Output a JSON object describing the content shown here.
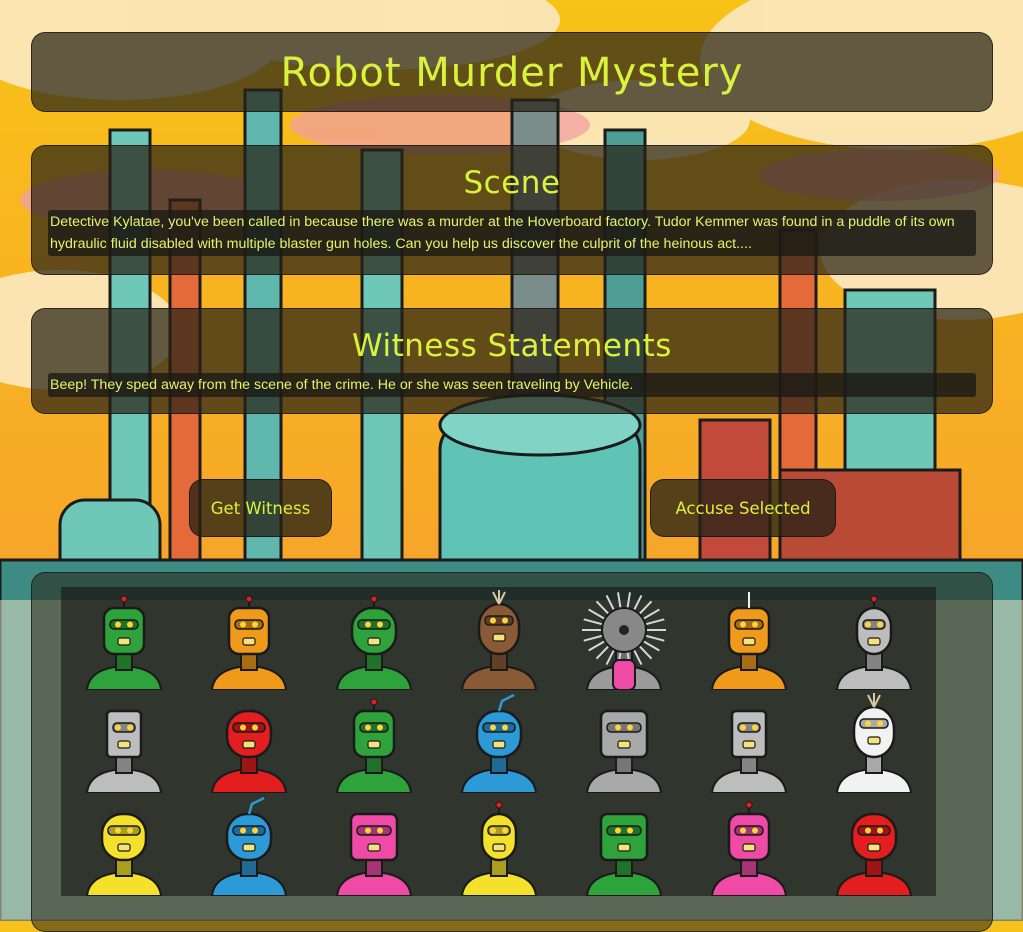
{
  "game": {
    "title": "Robot Murder Mystery"
  },
  "scene": {
    "heading": "Scene",
    "text": "Detective Kylatae, you've been called in because there was a murder at the Hoverboard factory. Tudor Kemmer was found in a puddle of its own hydraulic fluid disabled with multiple blaster gun holes. Can you help us discover the culprit of the heinous act...."
  },
  "witness": {
    "heading": "Witness Statements",
    "text": "Beep! They sped away from the scene of the crime. He or she was seen traveling by Vehicle."
  },
  "buttons": {
    "get_witness": "Get Witness",
    "accuse": "Accuse Selected"
  },
  "colors": {
    "accent_text": "#d9f23c",
    "panel_bg": "#28221a",
    "background": "#f6c21b"
  },
  "suspects": [
    {
      "color": "#2fa33b",
      "head": "tall",
      "antenna": "dot"
    },
    {
      "color": "#f09a1c",
      "head": "tall",
      "antenna": "dot"
    },
    {
      "color": "#2fa33b",
      "head": "round",
      "antenna": "dot"
    },
    {
      "color": "#8a5a36",
      "head": "egg",
      "antenna": "tuft"
    },
    {
      "color": "#9a9a9a",
      "head": "fuzzy",
      "antenna": "none"
    },
    {
      "color": "#f09a1c",
      "head": "tall",
      "antenna": "spike"
    },
    {
      "color": "#bdbdbd",
      "head": "capsule",
      "antenna": "dot"
    },
    {
      "color": "#bdbdbd",
      "head": "can",
      "antenna": "none"
    },
    {
      "color": "#e21e1e",
      "head": "round",
      "antenna": "none"
    },
    {
      "color": "#2fa33b",
      "head": "tall",
      "antenna": "dot"
    },
    {
      "color": "#2b9ad6",
      "head": "round",
      "antenna": "loop"
    },
    {
      "color": "#a8a8a8",
      "head": "boxy",
      "antenna": "none"
    },
    {
      "color": "#bdbdbd",
      "head": "can",
      "antenna": "none"
    },
    {
      "color": "#f2f2f2",
      "head": "egg",
      "antenna": "tuft"
    },
    {
      "color": "#f3e12b",
      "head": "round",
      "antenna": "none"
    },
    {
      "color": "#2b9ad6",
      "head": "round",
      "antenna": "loop"
    },
    {
      "color": "#ee4aa6",
      "head": "boxy",
      "antenna": "none"
    },
    {
      "color": "#f3e12b",
      "head": "capsule",
      "antenna": "dot"
    },
    {
      "color": "#2fa33b",
      "head": "boxy",
      "antenna": "none"
    },
    {
      "color": "#ee4aa6",
      "head": "tall",
      "antenna": "dot"
    },
    {
      "color": "#e21e1e",
      "head": "round",
      "antenna": "none"
    }
  ]
}
